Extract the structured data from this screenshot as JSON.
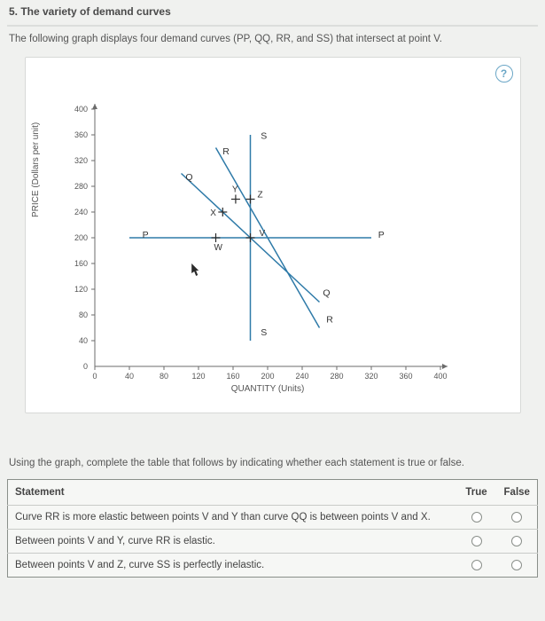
{
  "heading": "5. The variety of demand curves",
  "intro": "The following graph displays four demand curves (PP, QQ, RR, and SS) that intersect at point V.",
  "help_glyph": "?",
  "instructions": "Using the graph, complete the table that follows by indicating whether each statement is true or false.",
  "table": {
    "head_statement": "Statement",
    "head_true": "True",
    "head_false": "False",
    "rows": [
      {
        "text": "Curve RR is more elastic between points V and Y than curve QQ is between points V and X."
      },
      {
        "text": "Between points V and Y, curve RR is elastic."
      },
      {
        "text": "Between points V and Z, curve SS is perfectly inelastic."
      }
    ]
  },
  "chart_data": {
    "type": "line",
    "xlabel": "QUANTITY (Units)",
    "ylabel": "PRICE (Dollars per unit)",
    "xlim": [
      0,
      400
    ],
    "ylim": [
      0,
      400
    ],
    "xticks": [
      0,
      40,
      80,
      120,
      160,
      200,
      240,
      280,
      320,
      360,
      400
    ],
    "yticks": [
      0,
      40,
      80,
      120,
      160,
      200,
      240,
      280,
      320,
      360,
      400
    ],
    "series": [
      {
        "name": "P",
        "points": [
          [
            40,
            200
          ],
          [
            320,
            200
          ]
        ]
      },
      {
        "name": "Q",
        "points": [
          [
            100,
            300
          ],
          [
            260,
            100
          ]
        ]
      },
      {
        "name": "R",
        "points": [
          [
            140,
            340
          ],
          [
            260,
            60
          ]
        ]
      },
      {
        "name": "S",
        "points": [
          [
            180,
            40
          ],
          [
            180,
            360
          ]
        ]
      }
    ],
    "labeled_points": [
      {
        "name": "V",
        "x": 180,
        "y": 200
      },
      {
        "name": "W",
        "x": 140,
        "y": 200
      },
      {
        "name": "X",
        "x": 148,
        "y": 240
      },
      {
        "name": "Y",
        "x": 163,
        "y": 260
      },
      {
        "name": "Z",
        "x": 180,
        "y": 260
      }
    ],
    "curve_labels": [
      {
        "text": "P",
        "x": 55,
        "y": 200
      },
      {
        "text": "P",
        "x": 328,
        "y": 200
      },
      {
        "text": "Q",
        "x": 105,
        "y": 290
      },
      {
        "text": "Q",
        "x": 264,
        "y": 110
      },
      {
        "text": "R",
        "x": 148,
        "y": 330
      },
      {
        "text": "R",
        "x": 268,
        "y": 68
      },
      {
        "text": "S",
        "x": 192,
        "y": 354
      },
      {
        "text": "S",
        "x": 192,
        "y": 48
      }
    ]
  }
}
